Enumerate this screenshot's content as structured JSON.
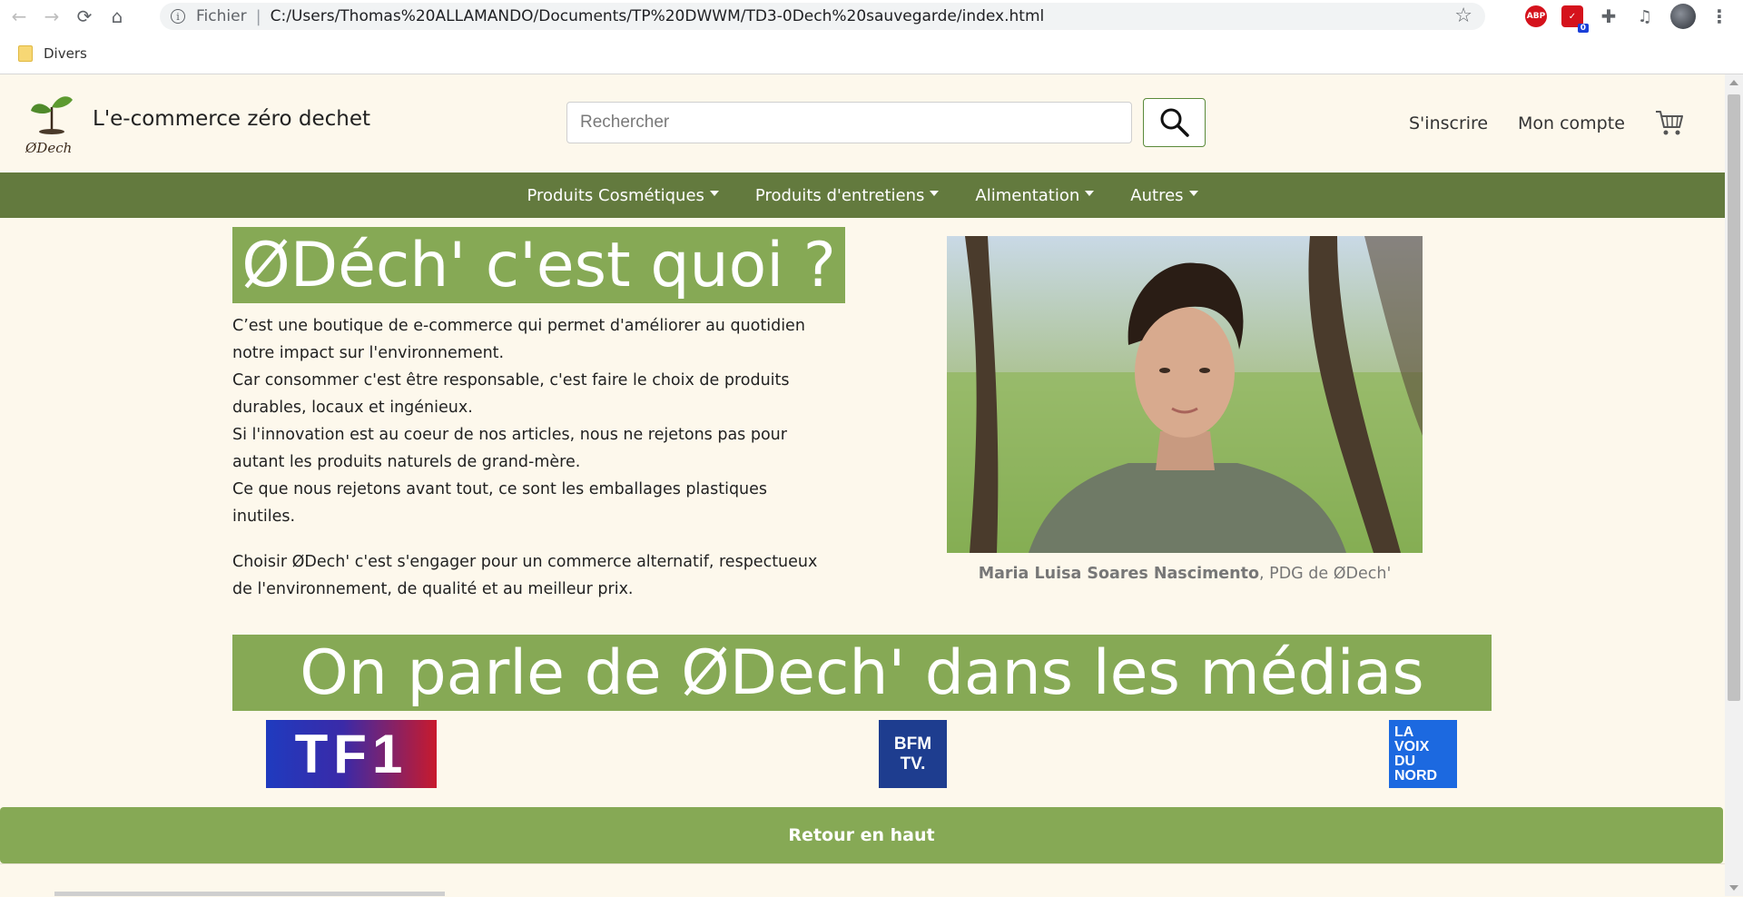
{
  "browser": {
    "scheme_label": "Fichier",
    "address": "C:/Users/Thomas%20ALLAMANDO/Documents/TP%20DWWM/TD3-0Dech%20sauvegarde/index.html",
    "extensions": {
      "adblock_label": "ABP",
      "todo_badge_count": "0"
    },
    "bookmark_folder": "Divers"
  },
  "header": {
    "logo_text": "ØDech",
    "brand_title": "L'e-commerce zéro dechet",
    "search_placeholder": "Rechercher",
    "signup_label": "S'inscrire",
    "account_label": "Mon compte"
  },
  "nav": {
    "items": [
      {
        "label": "Produits Cosmétiques"
      },
      {
        "label": "Produits d'entretiens"
      },
      {
        "label": "Alimentation"
      },
      {
        "label": "Autres"
      }
    ]
  },
  "about": {
    "heading": "ØDéch' c'est quoi ?",
    "paragraph1_lines": [
      "C’est une boutique de e-commerce qui permet d'améliorer au quotidien notre impact sur l'environnement.",
      "Car consommer c'est être responsable, c'est faire le choix de produits durables, locaux et ingénieux.",
      "Si l'innovation est au coeur de nos articles, nous ne rejetons pas pour autant les produits naturels de grand-mère.",
      "Ce que nous rejetons avant tout, ce sont les emballages plastiques inutiles."
    ],
    "paragraph2": "Choisir ØDech' c'est s'engager pour un commerce alternatif, respectueux de l'environnement, de qualité et au meilleur prix.",
    "caption_name": "Maria Luisa Soares Nascimento",
    "caption_role": ", PDG de ØDech'"
  },
  "media": {
    "heading": "On parle de ØDech' dans les médias",
    "logos": {
      "tf1": "TF1",
      "bfm_line1": "BFM",
      "bfm_line2": "TV.",
      "lvdn_lines": [
        "LA",
        "VOIX",
        "DU",
        "NORD"
      ]
    }
  },
  "footer": {
    "back_to_top": "Retour en haut"
  },
  "colors": {
    "page_bg": "#fdf8ec",
    "nav_bg": "#637a3e",
    "banner_green": "#86a955"
  }
}
